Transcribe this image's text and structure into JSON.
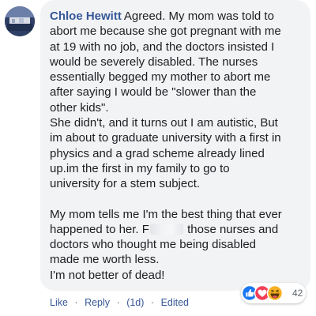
{
  "comment": {
    "author": "Chloe Hewitt",
    "line1": "Agreed. My mom was told to",
    "body_lines": [
      "abort me because she got pregnant with me",
      "at 19 with no job, and the doctors insisted I",
      "would be severely disabled. The nurses",
      "essentially begged my mother to abort me",
      "after saying I would be \"slower than the",
      "other kids\".",
      "She didn't, and it turns out I am autistic, But",
      "im about to graduate university with a first in",
      "physics and a grad scheme already lined",
      "up.im the first in my family to go to",
      "university for a stem subject."
    ],
    "para2_line1": "My mom tells me I'm the best thing that ever",
    "para2_line2_before": "happened to her. F",
    "para2_line2_after": " those nurses and",
    "para2_rest": [
      "doctors who thought me being disabled",
      "made me worth less.",
      "I'm not better of dead!"
    ]
  },
  "reactions": {
    "icons": [
      "like-icon",
      "love-icon",
      "haha-icon"
    ],
    "count": "42",
    "colors": {
      "like": "#1877f2",
      "love": "#f33e58",
      "haha": "#f7b125"
    }
  },
  "footer": {
    "like": "Like",
    "reply": "Reply",
    "time": "(1d)",
    "edited": "Edited",
    "separator": "·"
  }
}
